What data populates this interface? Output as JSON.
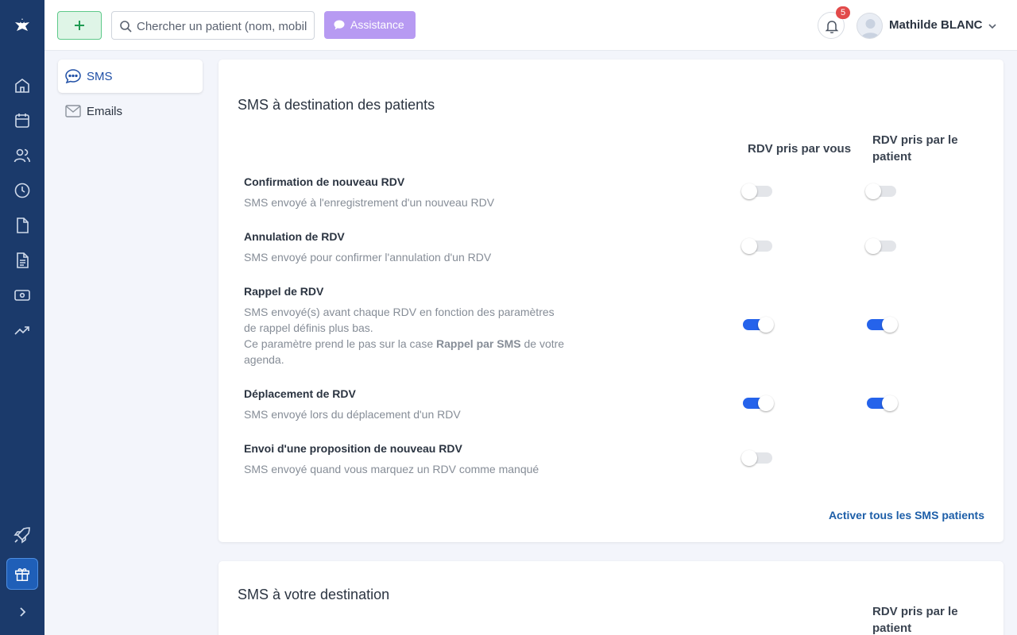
{
  "topbar": {
    "search_placeholder": "Chercher un patient (nom, mobile…)",
    "assist_label": "Assistance",
    "notif_count": "5",
    "user_name": "Mathilde BLANC"
  },
  "subnav": {
    "items": [
      {
        "label": "SMS",
        "active": true
      },
      {
        "label": "Emails",
        "active": false
      }
    ]
  },
  "patients_card": {
    "title": "SMS à destination des patients",
    "col_you": "RDV pris par vous",
    "col_patient_line1": "RDV pris par le",
    "col_patient_line2": "patient",
    "rows": [
      {
        "title": "Confirmation de nouveau RDV",
        "desc": "SMS envoyé à l'enregistrement d'un nouveau RDV",
        "you": false,
        "patient": false
      },
      {
        "title": "Annulation de RDV",
        "desc": "SMS envoyé pour confirmer l'annulation d'un RDV",
        "you": false,
        "patient": false
      },
      {
        "title": "Rappel de RDV",
        "desc_l1": "SMS envoyé(s) avant chaque RDV en fonction des paramètres",
        "desc_l2": "de rappel définis plus bas.",
        "desc_l3a": "Ce paramètre prend le pas sur la case ",
        "desc_l3b": "Rappel par SMS",
        "desc_l3c": " de votre",
        "desc_l4": "agenda.",
        "you": true,
        "patient": true
      },
      {
        "title": "Déplacement de RDV",
        "desc": "SMS envoyé lors du déplacement d'un RDV",
        "you": true,
        "patient": true
      },
      {
        "title": "Envoi d'une proposition de nouveau RDV",
        "desc": "SMS envoyé quand vous marquez un RDV comme manqué",
        "you": false
      }
    ],
    "activate_all": "Activer tous les SMS patients"
  },
  "you_card": {
    "title": "SMS à votre destination",
    "col_patient_line1": "RDV pris par le",
    "col_patient_line2": "patient"
  },
  "colors": {
    "rail": "#1b3a6b",
    "accent": "#2563eb",
    "assist": "#b79af2",
    "add": "#5ec98a",
    "badge": "#e24a4a"
  }
}
